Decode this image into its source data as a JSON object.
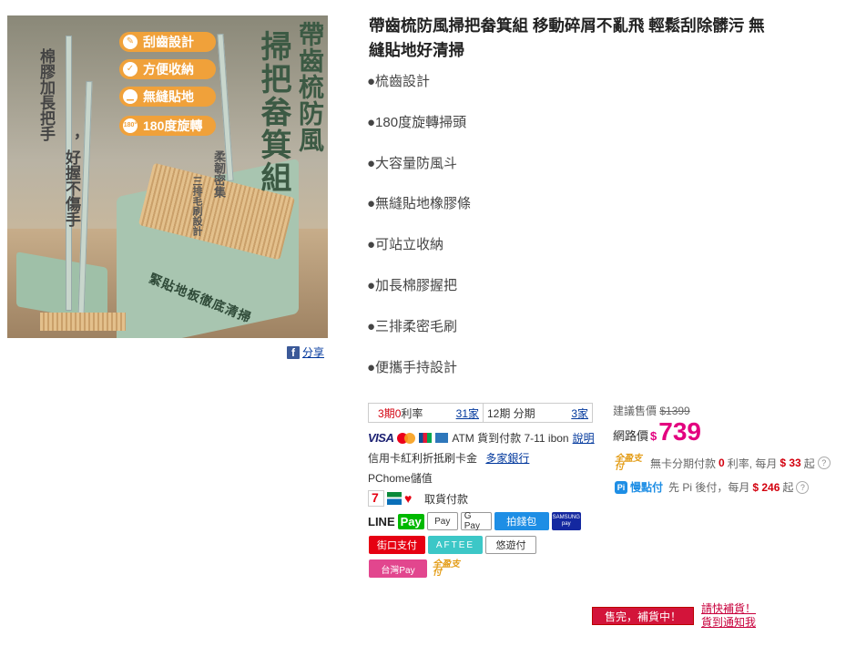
{
  "product": {
    "image": {
      "vertical_title_1": "帶齒梳防風",
      "vertical_title_2": "掃把畚箕組",
      "features": [
        "刮齒設計",
        "方便收納",
        "無縫貼地",
        "180度旋轉"
      ],
      "feature_badge_180": "180°",
      "left_text_1": "棉膠加長把手",
      "left_text_2": "，好握不傷手",
      "brush_text_1": "柔韌密集",
      "brush_text_2": "三排毛刷設計",
      "pan_text": "緊貼地板徹底清掃"
    },
    "share_label": "分享",
    "title": "帶齒梳防風掃把畚箕組 移動碎屑不亂飛 輕鬆刮除髒污 無縫貼地好清掃",
    "bullets": [
      "●梳齒設計",
      "●180度旋轉掃頭",
      "●大容量防風斗",
      "●無縫貼地橡膠條",
      "●可站立收納",
      "●加長棉膠握把",
      "●三排柔密毛刷",
      "●便攜手持設計"
    ]
  },
  "installment": {
    "cell1": {
      "period": "3期",
      "zero": "0",
      "rate_label": "利率",
      "banks": "31家"
    },
    "cell2": {
      "period": "12期 分期",
      "banks": "3家"
    }
  },
  "payments": {
    "cards_text": "ATM 貨到付款 7-11 ibon",
    "explain_link": "說明",
    "credit_text": "信用卡紅利折抵刷卡金",
    "bank_link": "多家銀行",
    "stored_value": "PChome儲值",
    "pickup_pay": "取貨付款",
    "buttons_row1": [
      "LINE Pay",
      "Apple Pay",
      "G Pay",
      "拍錢包",
      "SAMSUNG pay"
    ],
    "buttons_row2": [
      "街口支付",
      "AFTEE",
      "悠遊付"
    ],
    "buttons_row3": [
      "台灣Pay",
      "全盈支付"
    ]
  },
  "price": {
    "suggest_label": "建議售價",
    "suggest_price": "$1399",
    "net_label": "網路價",
    "currency": "$",
    "net_price": "739"
  },
  "gopay": {
    "logo": "全盈支付",
    "text_1": "無卡分期付款",
    "zero": "0",
    "text_2": "利率, 每月",
    "amount": "$ 33",
    "text_3": "起"
  },
  "pi": {
    "logo": "Pi",
    "brand": "慢點付",
    "text_1": "先 Pi 後付，每月",
    "amount": "$ 246",
    "text_2": "起"
  },
  "status": {
    "soldout_button": "售完，補貨中！",
    "notify_line1": "請快補貨！",
    "notify_line2": "貨到通知我"
  },
  "colors": {
    "price_pink": "#e3007f",
    "soldout_red": "#d3143a",
    "link_blue": "#00379c"
  }
}
